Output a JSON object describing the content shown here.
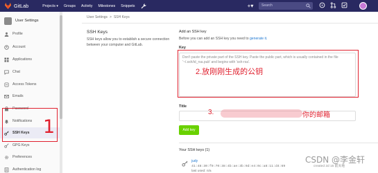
{
  "colors": {
    "navbar": "#292961",
    "accent_link": "#1f78d1",
    "button_green": "#69d100",
    "annotation_red": "#e0202e",
    "sidebar_active": "#ebebf5"
  },
  "navbar": {
    "brand": "GitLab",
    "items": [
      "Projects ▾",
      "Groups",
      "Activity",
      "Milestones",
      "Snippets"
    ],
    "plus_label": "+▾",
    "search_placeholder": "Search",
    "icons": [
      "wrench-icon",
      "search-icon",
      "issues-icon",
      "merge-request-icon",
      "todo-icon"
    ]
  },
  "sidebar": {
    "header": "User Settings",
    "items": [
      {
        "label": "Profile",
        "icon": "profile-icon"
      },
      {
        "label": "Account",
        "icon": "account-icon"
      },
      {
        "label": "Applications",
        "icon": "applications-icon"
      },
      {
        "label": "Chat",
        "icon": "chat-icon"
      },
      {
        "label": "Access Tokens",
        "icon": "access-tokens-icon"
      },
      {
        "label": "Emails",
        "icon": "emails-icon"
      },
      {
        "label": "Password",
        "icon": "password-icon"
      },
      {
        "label": "Notifications",
        "icon": "notifications-icon"
      },
      {
        "label": "SSH Keys",
        "icon": "key-icon",
        "active": true
      },
      {
        "label": "GPG Keys",
        "icon": "gpg-key-icon"
      },
      {
        "label": "Preferences",
        "icon": "preferences-icon"
      },
      {
        "label": "Authentication log",
        "icon": "auth-log-icon"
      }
    ]
  },
  "breadcrumb": {
    "parent": "User Settings",
    "sep": ">",
    "current": "SSH Keys"
  },
  "main": {
    "title": "SSH Keys",
    "description": "SSH keys allow you to establish a secure connection between your computer and GitLab.",
    "add_title": "Add an SSH key",
    "add_desc_before": "Before you can add an SSH key you need to ",
    "add_desc_link": "generate it.",
    "key_label": "Key",
    "key_placeholder": "Don't paste the private part of the SSH key. Paste the public part, which is usually contained in the file '~/.ssh/id_rsa.pub' and begins with 'ssh-rsa'.",
    "title_label": "Title",
    "title_value": "",
    "add_key_button": "Add key",
    "your_keys": "Your SSH keys (1)",
    "key_item": {
      "name": "judy",
      "fingerprint": "41:48:30:f9:70:38:4b:ae:3b:9d:e4:0c:a8:11:d4:69",
      "last_used": "last used: n/a",
      "created": "created 2d 15 前天地"
    }
  },
  "annotations": {
    "num_1": "1",
    "text_2": "2.放刚刚生成的公钥",
    "text_3_prefix": "3.",
    "text_3_suffix": "你的邮箱"
  },
  "watermark": "CSDN @李金轩"
}
